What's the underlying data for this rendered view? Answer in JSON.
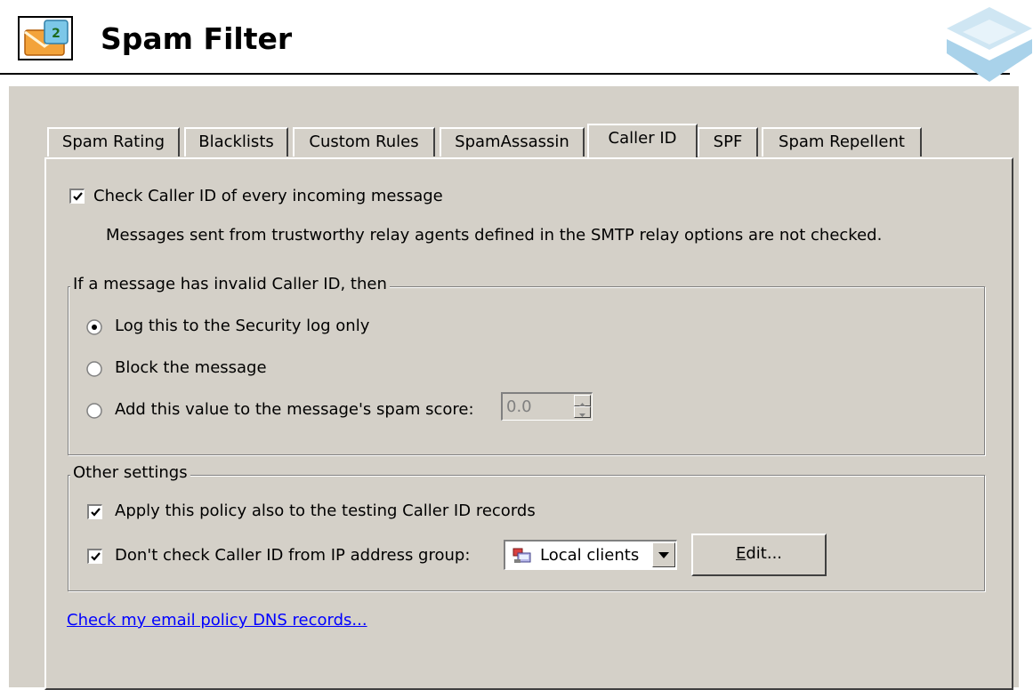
{
  "header": {
    "title": "Spam Filter",
    "icon": "mail-envelope-icon",
    "logo": "brand-corner-logo"
  },
  "tabs": [
    {
      "label": "Spam Rating",
      "active": false
    },
    {
      "label": "Blacklists",
      "active": false
    },
    {
      "label": "Custom Rules",
      "active": false
    },
    {
      "label": "SpamAssassin",
      "active": false
    },
    {
      "label": "Caller ID",
      "active": true
    },
    {
      "label": "SPF",
      "active": false
    },
    {
      "label": "Spam Repellent",
      "active": false
    }
  ],
  "caller_id": {
    "check_every": {
      "label": "Check Caller ID of every incoming message",
      "checked": true
    },
    "note": "Messages sent from trustworthy relay agents defined in the SMTP relay options are not checked.",
    "invalid_group": {
      "title": "If a message has invalid Caller ID, then",
      "options": [
        {
          "label": "Log this to the Security log only",
          "selected": true
        },
        {
          "label": "Block the message",
          "selected": false
        },
        {
          "label": "Add this value to the message's spam score:",
          "selected": false
        }
      ],
      "spam_score": "0.0"
    },
    "other_group": {
      "title": "Other settings",
      "apply_testing": {
        "label": "Apply this policy also to the testing Caller ID records",
        "checked": true
      },
      "dont_check": {
        "label": "Don't check Caller ID from IP address group:",
        "checked": true
      },
      "ip_group": {
        "selected": "Local clients",
        "icon": "ip-group-icon"
      },
      "edit_button": {
        "underlined": "E",
        "rest": "dit..."
      }
    },
    "dns_link": "Check my email policy DNS records..."
  },
  "colors": {
    "panel": "#d4d0c8",
    "link": "#0000ff"
  }
}
